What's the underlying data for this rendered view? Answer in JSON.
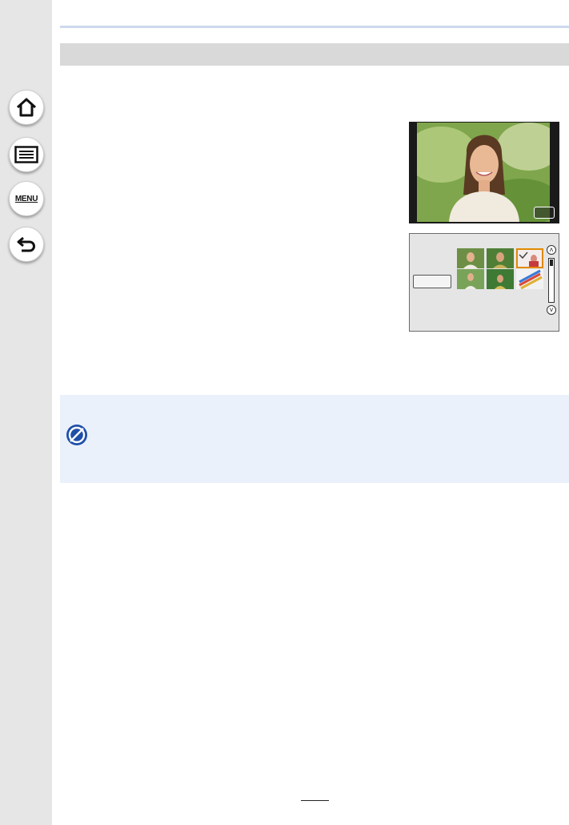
{
  "sidebar": {
    "items": [
      {
        "icon": "home-icon"
      },
      {
        "icon": "contents-list-icon"
      },
      {
        "icon": "menu-icon",
        "label": "MENU"
      },
      {
        "icon": "back-icon"
      }
    ]
  },
  "screen1": {
    "icon": "camera-screen-portrait"
  },
  "screen2": {
    "icon": "camera-screen-thumbnail-selection"
  },
  "note": {
    "icon": "not-available-icon"
  },
  "colors": {
    "sidebar_bg": "#e6e6e6",
    "section_bar": "#d9d9d9",
    "note_bg": "#eaf1fb",
    "accent": "#1f4fa8",
    "selection": "#e08a00"
  }
}
